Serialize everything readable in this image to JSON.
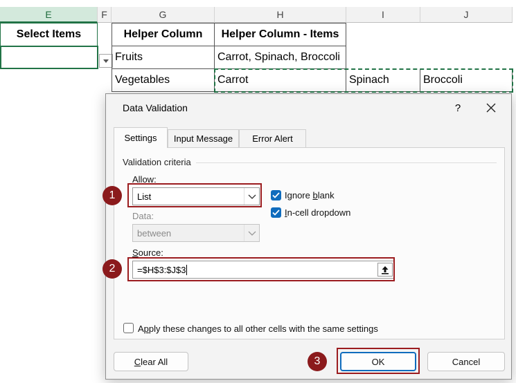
{
  "sheet": {
    "columns": [
      "E",
      "F",
      "G",
      "H",
      "I",
      "J"
    ],
    "e1_label": "Select Items",
    "table": {
      "headers": [
        "Helper Column",
        "Helper Column - Items"
      ],
      "rows": [
        [
          "Fruits",
          "Carrot, Spinach, Broccoli"
        ],
        [
          "Vegetables",
          "Carrot"
        ]
      ],
      "extra_cells": [
        "Spinach",
        "Broccoli"
      ]
    }
  },
  "dialog": {
    "title": "Data Validation",
    "help": "?",
    "tabs": [
      "Settings",
      "Input Message",
      "Error Alert"
    ],
    "group_label": "Validation criteria",
    "allow": {
      "label_pre": "",
      "label_acc": "A",
      "label_post": "llow:",
      "value": "List"
    },
    "ignore_blank": {
      "pre": "Ignore ",
      "acc": "b",
      "post": "lank",
      "checked": true
    },
    "in_cell_dropdown": {
      "pre": "",
      "acc": "I",
      "post": "n-cell dropdown",
      "checked": true
    },
    "data": {
      "label": "Data:",
      "value": "between"
    },
    "source": {
      "label_acc": "S",
      "label_post": "ource:",
      "value": "=$H$3:$J$3"
    },
    "apply_all": {
      "pre": "A",
      "acc": "p",
      "post": "ply these changes to all other cells with the same settings",
      "checked": false
    },
    "buttons": {
      "clear_all": {
        "acc": "C",
        "post": "lear All"
      },
      "ok": "OK",
      "cancel": "Cancel"
    },
    "annotations": [
      "1",
      "2",
      "3"
    ]
  },
  "colors": {
    "excel_green": "#217346",
    "accent_blue": "#0f6cbd",
    "annotation_red": "#8b1a1c"
  },
  "icons": [
    "dropdown-arrow-icon",
    "close-icon",
    "chevron-down-icon",
    "collapse-upload-icon",
    "checkmark-icon"
  ]
}
